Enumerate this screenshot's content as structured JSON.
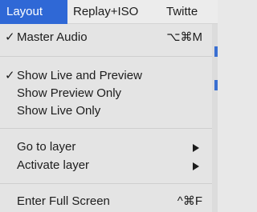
{
  "menubar": {
    "items": [
      {
        "label": "Layout"
      },
      {
        "label": "Replay+ISO"
      },
      {
        "label": "Twitte"
      }
    ]
  },
  "menu": {
    "master_audio": {
      "check": "✓",
      "label": "Master Audio",
      "shortcut": "⌥⌘M"
    },
    "show_live_and_preview": {
      "check": "✓",
      "label": "Show Live and Preview"
    },
    "show_preview_only": {
      "label": "Show Preview Only"
    },
    "show_live_only": {
      "label": "Show Live Only"
    },
    "go_to_layer": {
      "label": "Go to layer"
    },
    "activate_layer": {
      "label": "Activate layer"
    },
    "enter_full_screen": {
      "label": "Enter Full Screen",
      "shortcut": "^⌘F"
    }
  },
  "colors": {
    "accent": "#2f68d6",
    "menu_background": "#e4e4e4",
    "text": "#1c1c1c"
  }
}
